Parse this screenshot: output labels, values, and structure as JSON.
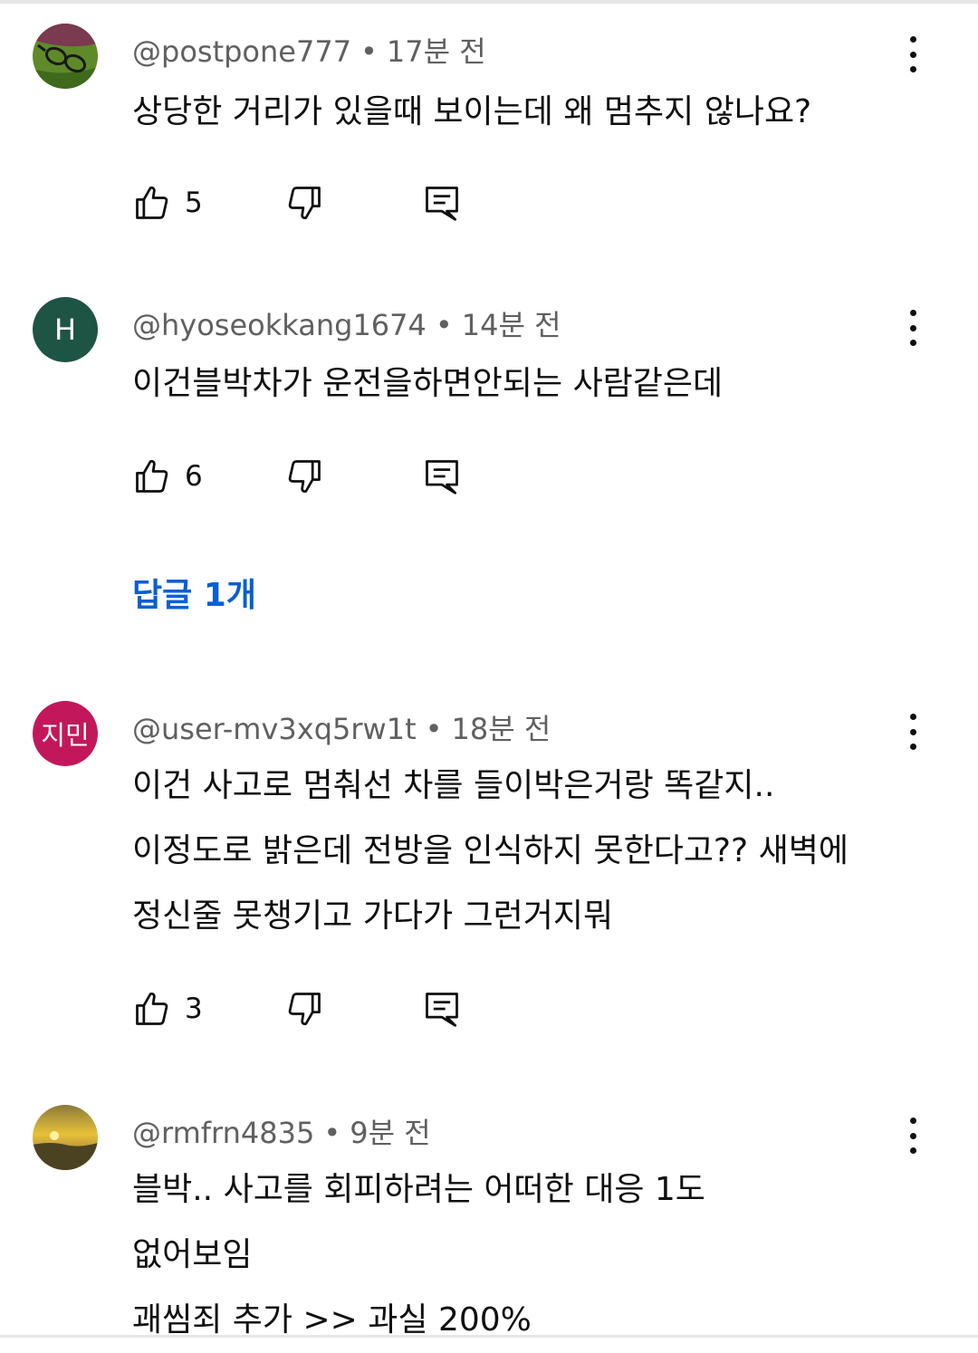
{
  "comments": [
    {
      "handle": "@postpone777",
      "sep": "•",
      "time": "17분 전",
      "avatar": {
        "type": "image",
        "icon": "glasses-on-green"
      },
      "lines": [
        "상당한 거리가 있을때 보이는데 왜 멈추지 않나요?"
      ],
      "likes": "5"
    },
    {
      "handle": "@hyoseokkang1674",
      "sep": "•",
      "time": "14분 전",
      "avatar": {
        "type": "letter",
        "letter": "H",
        "color": "#1e5444"
      },
      "lines": [
        "이건블박차가 운전을하면안되는 사람같은데"
      ],
      "likes": "6",
      "replies_label": "답글 1개"
    },
    {
      "handle": "@user-mv3xq5rw1t",
      "sep": "•",
      "time": "18분 전",
      "avatar": {
        "type": "letter",
        "letter": "지민",
        "color": "#c2185b"
      },
      "lines": [
        "이건 사고로 멈춰선 차를 들이박은거랑 똑같지..",
        "이정도로 밝은데 전방을 인식하지 못한다고?? 새벽에",
        "정신줄 못챙기고 가다가 그런거지뭐"
      ],
      "likes": "3"
    },
    {
      "handle": "@rmfrn4835",
      "sep": "•",
      "time": "9분 전",
      "avatar": {
        "type": "image",
        "icon": "sunset-landscape"
      },
      "lines": [
        "블박.. 사고를 회피하려는 어떠한 대응 1도",
        "없어보임",
        "괘씸죄 추가 >> 과실 200%"
      ]
    }
  ],
  "colors": {
    "link": "#065fd4",
    "meta": "#606060",
    "text": "#0f0f0f"
  }
}
